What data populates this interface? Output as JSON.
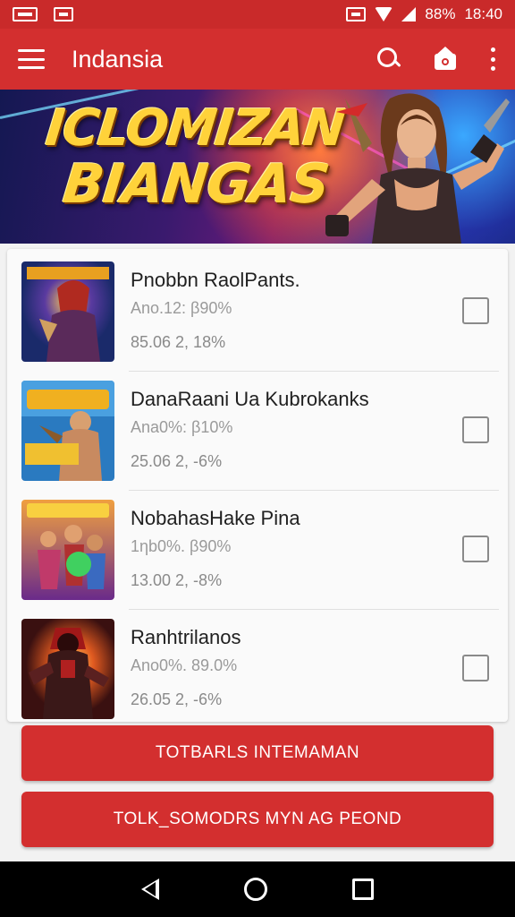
{
  "status_bar": {
    "battery": "88%",
    "time": "18:40"
  },
  "app_bar": {
    "title": "Indansia",
    "icons": [
      "menu-icon",
      "search-icon",
      "home-icon",
      "more-icon"
    ]
  },
  "banner": {
    "line1": "ICLOMIZAN",
    "line2": "BIANGAS"
  },
  "games": [
    {
      "name": "Pnobbn RaolPants.",
      "meta1": "Ano.12: β90%",
      "meta2": "85.06 2, 18%"
    },
    {
      "name": "DanaRaani Ua Kubrokanks",
      "meta1": "Ana0%: β10%",
      "meta2": "25.06 2, -6%"
    },
    {
      "name": "NobahasHake Pina",
      "meta1": "1ηb0%. β90%",
      "meta2": "13.00 2, -8%"
    },
    {
      "name": "Ranhtrilanos",
      "meta1": "Ano0%. 89.0%",
      "meta2": "26.05 2, -6%"
    }
  ],
  "buttons": {
    "primary": "TOTBARLS INTEMAMAN",
    "secondary": "TOLK_SOMODRS MYN AG PEOND"
  },
  "colors": {
    "primary": "#d32f2f",
    "status_bar": "#c92a2a",
    "nav_bar": "#000000"
  }
}
